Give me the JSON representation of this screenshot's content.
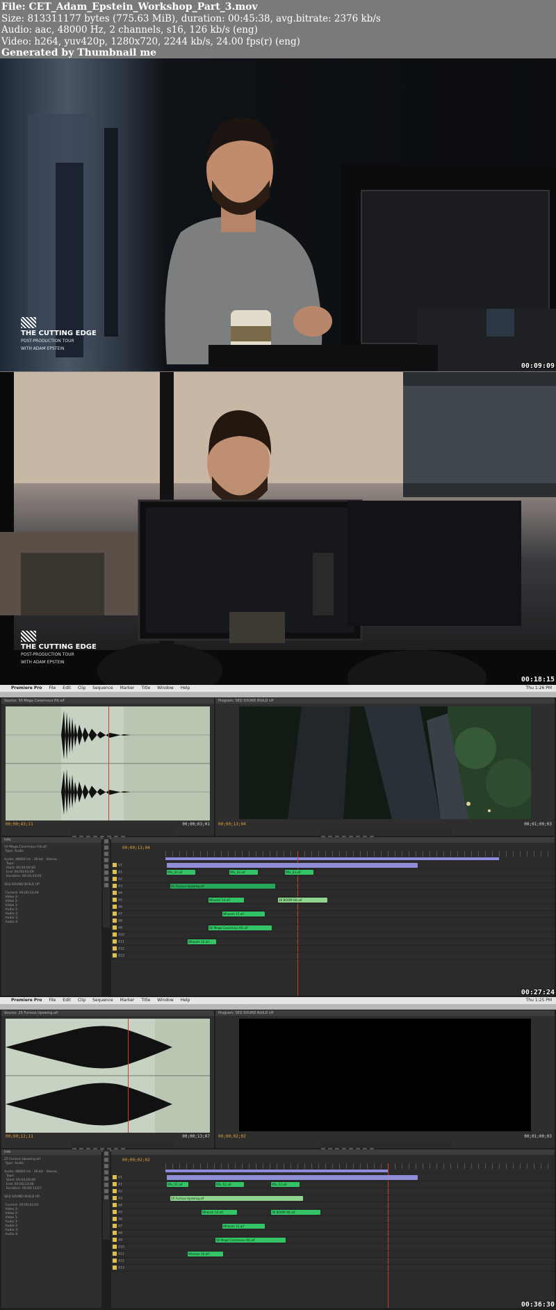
{
  "header": {
    "file": "File: CET_Adam_Epstein_Workshop_Part_3.mov",
    "size": "Size: 813311177 bytes (775.63 MiB), duration: 00:45:38, avg.bitrate: 2376 kb/s",
    "audio": "Audio: aac, 48000 Hz, 2 channels, s16, 126 kb/s (eng)",
    "video": "Video: h264, yuv420p, 1280x720, 2244 kb/s, 24.00 fps(r) (eng)",
    "generated": "Generated by Thumbnail me"
  },
  "frames": [
    {
      "timestamp": "00:09:09"
    },
    {
      "timestamp": "00:18:15"
    },
    {
      "timestamp": "00:27:24"
    },
    {
      "timestamp": "00:36:30"
    }
  ],
  "logo": {
    "line1": "THE CUTTING EDGE",
    "line2": "POST-PRODUCTION TOUR",
    "line3": "WITH ADAM EPSTEIN"
  },
  "premiere": {
    "menu": [
      "Premiere Pro",
      "File",
      "Edit",
      "Clip",
      "Sequence",
      "Marker",
      "Title",
      "Window",
      "Help"
    ],
    "clock_a": "Thu 1:26 PM",
    "clock_b": "Thu 1:25 PM",
    "source_tab_a": "Source: 50 Mega Cavernous Hit.aif",
    "source_tab_b": "Source: 25 Furious Upswing.aif",
    "program_tab": "Program: SEQ SOUND BUILD UP",
    "tc_a_left": "00;00;43;11",
    "tc_a_right": "00;00;03;01",
    "tc_a_prog": "00;00;13;04",
    "tc_a_prog_right": "00;01;00;03",
    "tc_b_left": "00;00;12;11",
    "tc_b_right": "00;00;13;07",
    "tc_b_prog": "00;00;02;02",
    "tc_b_prog_right": "00;01;00;03",
    "seq_tc_a": "00;00;13;04",
    "seq_tc_b": "00;00;02;02",
    "meta_a": "50 Mega Cavernous Hit.aif\n Type: Audio\n\nAudio: 48000 Hz - 16-bit - Stereo\n  Tape:\n  Start: 00;00;00;00\n  End: 00;00;03;00\n  Duration: 00;00;03;01\n\nSEQ SOUND BUILD UP\n\n Current: 00;00;13;04\n Video 3:\n Video 2:\n Video 1:\n Audio 1:\n Audio 2:\n Audio 3:\n Audio 4:",
    "meta_b": "25 Furious Upswing.aif\n Type: Audio\n\nAudio: 48000 Hz - 16-bit - Stereo\n  Tape:\n  Start: 00;00;00;00\n  End: 00;00;13;06\n  Duration: 00;00;13;07\n\nSEQ SOUND BUILD UP\n\n Current: 00;00;02;02\n Video 3:\n Video 2:\n Video 1:\n Audio 1:\n Audio 2:\n Audio 3:\n Audio 4:",
    "tracks": [
      "V1",
      "A1",
      "A2",
      "A3",
      "A4",
      "A5",
      "A6",
      "A7",
      "A8",
      "A9",
      "A10",
      "A11",
      "A12",
      "A13"
    ],
    "clips_a": [
      {
        "label": "Mfx_02.aif"
      },
      {
        "label": "Mfx_02.aif"
      },
      {
        "label": "Mfx_03.aif"
      },
      {
        "label": "01 Furious Upswing.aif"
      },
      {
        "label": "Whoosh 14.aif"
      },
      {
        "label": "30 BOOM Hit.aif"
      },
      {
        "label": "Whoosh 15.aif"
      },
      {
        "label": "50 Mega Cavernous Hit.aif"
      },
      {
        "label": "Whoosh 16.aif"
      }
    ],
    "clips_b": [
      {
        "label": "Mfx_01.aif"
      },
      {
        "label": "Mfx_02.aif"
      },
      {
        "label": "Mfx_03.aif"
      },
      {
        "label": "25 Furious Upswing.aif"
      },
      {
        "label": "Whoosh 14.aif"
      },
      {
        "label": "30 BOOM Hit.aif"
      },
      {
        "label": "Whoosh 15.aif"
      },
      {
        "label": "50 Mega Cavernous Hit.aif"
      },
      {
        "label": "Whoosh 16.aif"
      }
    ]
  }
}
